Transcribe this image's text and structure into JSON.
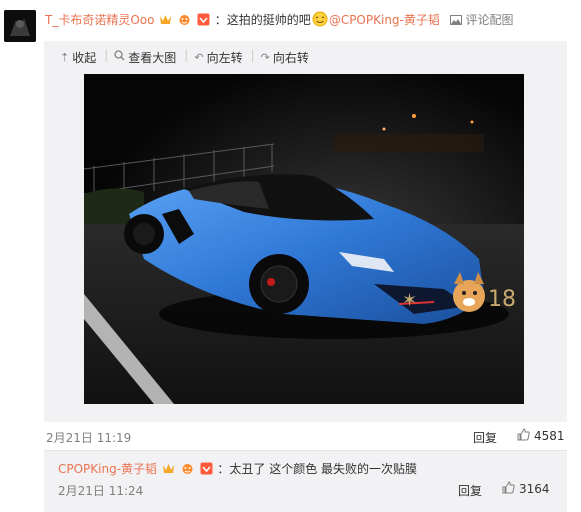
{
  "post": {
    "user_name": "T_卡布奇诺精灵Ooo",
    "sep": "：",
    "text": "这拍的挺帅的吧",
    "mention": "@CPOPKing-黄子韬",
    "comment_image_label": "评论配图",
    "toolbar": {
      "collapse": "收起",
      "view_large": "查看大图",
      "rotate_left": "向左转",
      "rotate_right": "向右转"
    },
    "time": "2月21日 11:19",
    "reply_label": "回复",
    "like_count": "4581"
  },
  "subreply": {
    "user_name": "CPOPKing-黄子韬",
    "sep": "：",
    "text": "太丑了 这个颜色 最失败的一次贴膜",
    "time": "2月21日 11:24",
    "reply_label": "回复",
    "like_count": "3164"
  },
  "colors": {
    "accent": "#eb7350",
    "gray": "#808080",
    "panel": "#f2f2f5",
    "car": "#2f78d6"
  },
  "icons": [
    "crown-icon",
    "vip-icon",
    "badge-icon",
    "smile-emoji",
    "image-icon",
    "thumb-up-icon",
    "rotate-left-icon",
    "rotate-right-icon",
    "collapse-icon",
    "search-icon"
  ]
}
